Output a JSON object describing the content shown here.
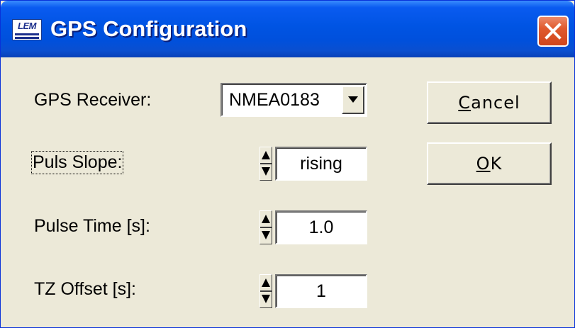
{
  "window": {
    "title": "GPS Configuration",
    "app_icon_text": "LEM",
    "close_icon": "close-x-icon"
  },
  "form": {
    "receiver": {
      "label": "GPS Receiver:",
      "value": "NMEA0183",
      "dropdown_icon": "chevron-down-icon"
    },
    "puls_slope": {
      "label": "Puls Slope:",
      "value": "rising"
    },
    "pulse_time": {
      "label": "Pulse Time [s]:",
      "value": "1.0"
    },
    "tz_offset": {
      "label": "TZ Offset [s]:",
      "value": "1"
    }
  },
  "buttons": {
    "cancel": {
      "first": "C",
      "rest": "ancel"
    },
    "ok": {
      "first": "O",
      "rest": "K"
    }
  },
  "colors": {
    "title_bar": "#0054e3",
    "dialog_bg": "#ece9d8",
    "close_button": "#e05a2e"
  }
}
